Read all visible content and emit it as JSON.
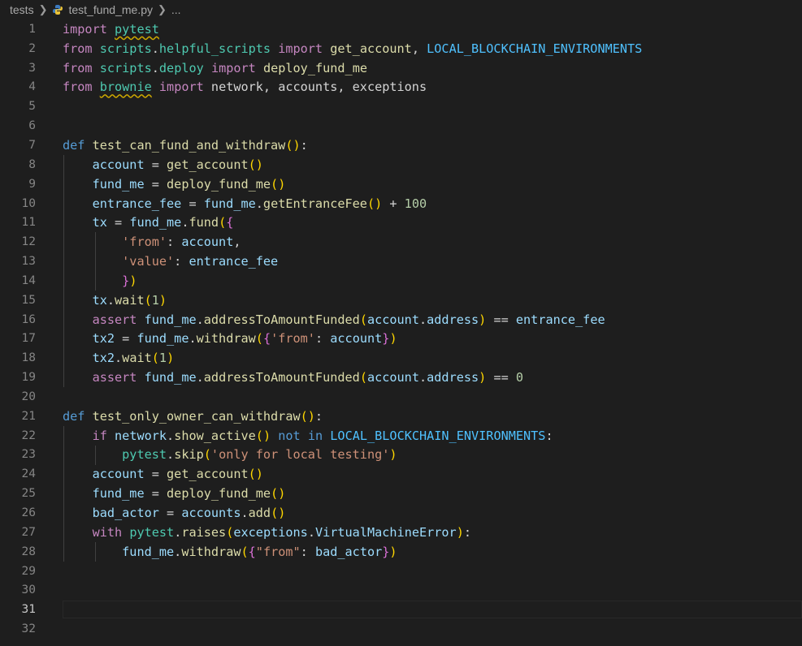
{
  "breadcrumb": {
    "folder": "tests",
    "file": "test_fund_me.py",
    "more": "..."
  },
  "editor": {
    "active_line": 31,
    "lines": [
      {
        "n": "1",
        "tokens": [
          [
            "k",
            "import"
          ],
          [
            "op",
            " "
          ],
          [
            "sq",
            "pytest"
          ]
        ]
      },
      {
        "n": "2",
        "tokens": [
          [
            "k",
            "from"
          ],
          [
            "op",
            " "
          ],
          [
            "md",
            "scripts"
          ],
          [
            "op",
            "."
          ],
          [
            "md",
            "helpful_scripts"
          ],
          [
            "op",
            " "
          ],
          [
            "k",
            "import"
          ],
          [
            "op",
            " "
          ],
          [
            "fn",
            "get_account"
          ],
          [
            "op",
            ", "
          ],
          [
            "cn",
            "LOCAL_BLOCKCHAIN_ENVIRONMENTS"
          ]
        ]
      },
      {
        "n": "3",
        "tokens": [
          [
            "k",
            "from"
          ],
          [
            "op",
            " "
          ],
          [
            "md",
            "scripts"
          ],
          [
            "op",
            "."
          ],
          [
            "md",
            "deploy"
          ],
          [
            "op",
            " "
          ],
          [
            "k",
            "import"
          ],
          [
            "op",
            " "
          ],
          [
            "fn",
            "deploy_fund_me"
          ]
        ]
      },
      {
        "n": "4",
        "tokens": [
          [
            "k",
            "from"
          ],
          [
            "op",
            " "
          ],
          [
            "sq",
            "brownie"
          ],
          [
            "op",
            " "
          ],
          [
            "k",
            "import"
          ],
          [
            "op",
            " network, accounts, exceptions"
          ]
        ]
      },
      {
        "n": "5",
        "tokens": []
      },
      {
        "n": "6",
        "tokens": []
      },
      {
        "n": "7",
        "tokens": [
          [
            "kd",
            "def"
          ],
          [
            "op",
            " "
          ],
          [
            "fn",
            "test_can_fund_and_withdraw"
          ],
          [
            "p1",
            "()"
          ],
          [
            "op",
            ":"
          ]
        ]
      },
      {
        "n": "8",
        "tokens": [
          [
            "op",
            "    "
          ],
          [
            "vr",
            "account"
          ],
          [
            "op",
            " = "
          ],
          [
            "fn",
            "get_account"
          ],
          [
            "p1",
            "()"
          ]
        ]
      },
      {
        "n": "9",
        "tokens": [
          [
            "op",
            "    "
          ],
          [
            "vr",
            "fund_me"
          ],
          [
            "op",
            " = "
          ],
          [
            "fn",
            "deploy_fund_me"
          ],
          [
            "p1",
            "()"
          ]
        ]
      },
      {
        "n": "10",
        "tokens": [
          [
            "op",
            "    "
          ],
          [
            "vr",
            "entrance_fee"
          ],
          [
            "op",
            " = "
          ],
          [
            "vr",
            "fund_me"
          ],
          [
            "op",
            "."
          ],
          [
            "fn",
            "getEntranceFee"
          ],
          [
            "p1",
            "()"
          ],
          [
            "op",
            " + "
          ],
          [
            "nm",
            "100"
          ]
        ]
      },
      {
        "n": "11",
        "tokens": [
          [
            "op",
            "    "
          ],
          [
            "vr",
            "tx"
          ],
          [
            "op",
            " = "
          ],
          [
            "vr",
            "fund_me"
          ],
          [
            "op",
            "."
          ],
          [
            "fn",
            "fund"
          ],
          [
            "p1",
            "("
          ],
          [
            "p2",
            "{"
          ]
        ]
      },
      {
        "n": "12",
        "tokens": [
          [
            "op",
            "        "
          ],
          [
            "st",
            "'from'"
          ],
          [
            "op",
            ": "
          ],
          [
            "vr",
            "account"
          ],
          [
            "op",
            ","
          ]
        ]
      },
      {
        "n": "13",
        "tokens": [
          [
            "op",
            "        "
          ],
          [
            "st",
            "'value'"
          ],
          [
            "op",
            ": "
          ],
          [
            "vr",
            "entrance_fee"
          ]
        ]
      },
      {
        "n": "14",
        "tokens": [
          [
            "op",
            "        "
          ],
          [
            "p2",
            "}"
          ],
          [
            "p1",
            ")"
          ]
        ]
      },
      {
        "n": "15",
        "tokens": [
          [
            "op",
            "    "
          ],
          [
            "vr",
            "tx"
          ],
          [
            "op",
            "."
          ],
          [
            "fn",
            "wait"
          ],
          [
            "p1",
            "("
          ],
          [
            "nm",
            "1"
          ],
          [
            "p1",
            ")"
          ]
        ]
      },
      {
        "n": "16",
        "tokens": [
          [
            "op",
            "    "
          ],
          [
            "k",
            "assert"
          ],
          [
            "op",
            " "
          ],
          [
            "vr",
            "fund_me"
          ],
          [
            "op",
            "."
          ],
          [
            "fn",
            "addressToAmountFunded"
          ],
          [
            "p1",
            "("
          ],
          [
            "vr",
            "account"
          ],
          [
            "op",
            "."
          ],
          [
            "vr",
            "address"
          ],
          [
            "p1",
            ")"
          ],
          [
            "op",
            " == "
          ],
          [
            "vr",
            "entrance_fee"
          ]
        ]
      },
      {
        "n": "17",
        "tokens": [
          [
            "op",
            "    "
          ],
          [
            "vr",
            "tx2"
          ],
          [
            "op",
            " = "
          ],
          [
            "vr",
            "fund_me"
          ],
          [
            "op",
            "."
          ],
          [
            "fn",
            "withdraw"
          ],
          [
            "p1",
            "("
          ],
          [
            "p2",
            "{"
          ],
          [
            "st",
            "'from'"
          ],
          [
            "op",
            ": "
          ],
          [
            "vr",
            "account"
          ],
          [
            "p2",
            "}"
          ],
          [
            "p1",
            ")"
          ]
        ]
      },
      {
        "n": "18",
        "tokens": [
          [
            "op",
            "    "
          ],
          [
            "vr",
            "tx2"
          ],
          [
            "op",
            "."
          ],
          [
            "fn",
            "wait"
          ],
          [
            "p1",
            "("
          ],
          [
            "nm",
            "1"
          ],
          [
            "p1",
            ")"
          ]
        ]
      },
      {
        "n": "19",
        "tokens": [
          [
            "op",
            "    "
          ],
          [
            "k",
            "assert"
          ],
          [
            "op",
            " "
          ],
          [
            "vr",
            "fund_me"
          ],
          [
            "op",
            "."
          ],
          [
            "fn",
            "addressToAmountFunded"
          ],
          [
            "p1",
            "("
          ],
          [
            "vr",
            "account"
          ],
          [
            "op",
            "."
          ],
          [
            "vr",
            "address"
          ],
          [
            "p1",
            ")"
          ],
          [
            "op",
            " == "
          ],
          [
            "nm",
            "0"
          ]
        ]
      },
      {
        "n": "20",
        "tokens": []
      },
      {
        "n": "21",
        "tokens": [
          [
            "kd",
            "def"
          ],
          [
            "op",
            " "
          ],
          [
            "fn",
            "test_only_owner_can_withdraw"
          ],
          [
            "p1",
            "()"
          ],
          [
            "op",
            ":"
          ]
        ]
      },
      {
        "n": "22",
        "tokens": [
          [
            "op",
            "    "
          ],
          [
            "k",
            "if"
          ],
          [
            "op",
            " "
          ],
          [
            "vr",
            "network"
          ],
          [
            "op",
            "."
          ],
          [
            "fn",
            "show_active"
          ],
          [
            "p1",
            "()"
          ],
          [
            "op",
            " "
          ],
          [
            "kd",
            "not in"
          ],
          [
            "op",
            " "
          ],
          [
            "cn",
            "LOCAL_BLOCKCHAIN_ENVIRONMENTS"
          ],
          [
            "op",
            ":"
          ]
        ]
      },
      {
        "n": "23",
        "tokens": [
          [
            "op",
            "        "
          ],
          [
            "md",
            "pytest"
          ],
          [
            "op",
            "."
          ],
          [
            "fn",
            "skip"
          ],
          [
            "p1",
            "("
          ],
          [
            "st",
            "'only for local testing'"
          ],
          [
            "p1",
            ")"
          ]
        ]
      },
      {
        "n": "24",
        "tokens": [
          [
            "op",
            "    "
          ],
          [
            "vr",
            "account"
          ],
          [
            "op",
            " = "
          ],
          [
            "fn",
            "get_account"
          ],
          [
            "p1",
            "()"
          ]
        ]
      },
      {
        "n": "25",
        "tokens": [
          [
            "op",
            "    "
          ],
          [
            "vr",
            "fund_me"
          ],
          [
            "op",
            " = "
          ],
          [
            "fn",
            "deploy_fund_me"
          ],
          [
            "p1",
            "()"
          ]
        ]
      },
      {
        "n": "26",
        "tokens": [
          [
            "op",
            "    "
          ],
          [
            "vr",
            "bad_actor"
          ],
          [
            "op",
            " = "
          ],
          [
            "vr",
            "accounts"
          ],
          [
            "op",
            "."
          ],
          [
            "fn",
            "add"
          ],
          [
            "p1",
            "()"
          ]
        ]
      },
      {
        "n": "27",
        "tokens": [
          [
            "op",
            "    "
          ],
          [
            "k",
            "with"
          ],
          [
            "op",
            " "
          ],
          [
            "md",
            "pytest"
          ],
          [
            "op",
            "."
          ],
          [
            "fn",
            "raises"
          ],
          [
            "p1",
            "("
          ],
          [
            "vr",
            "exceptions"
          ],
          [
            "op",
            "."
          ],
          [
            "vr",
            "VirtualMachineError"
          ],
          [
            "p1",
            ")"
          ],
          [
            "op",
            ":"
          ]
        ]
      },
      {
        "n": "28",
        "tokens": [
          [
            "op",
            "        "
          ],
          [
            "vr",
            "fund_me"
          ],
          [
            "op",
            "."
          ],
          [
            "fn",
            "withdraw"
          ],
          [
            "p1",
            "("
          ],
          [
            "p2",
            "{"
          ],
          [
            "st",
            "\"from\""
          ],
          [
            "op",
            ": "
          ],
          [
            "vr",
            "bad_actor"
          ],
          [
            "p2",
            "}"
          ],
          [
            "p1",
            ")"
          ]
        ]
      },
      {
        "n": "29",
        "tokens": []
      },
      {
        "n": "30",
        "tokens": []
      },
      {
        "n": "31",
        "tokens": []
      },
      {
        "n": "32",
        "tokens": []
      }
    ]
  }
}
